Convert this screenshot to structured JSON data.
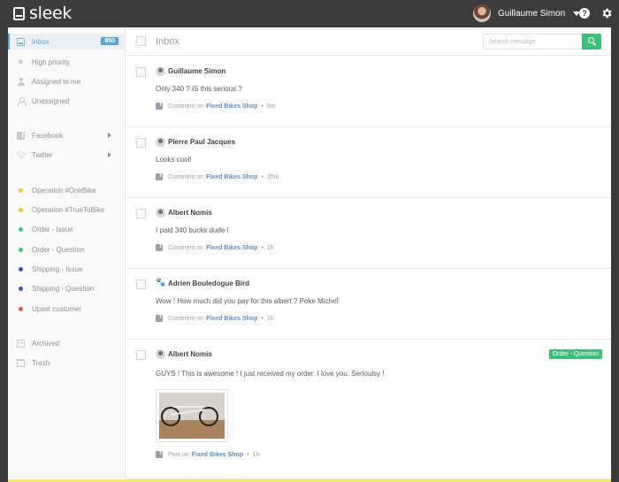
{
  "app": {
    "name": "sleek"
  },
  "user": {
    "name": "Guillaume Simon"
  },
  "sidebar": {
    "items": [
      {
        "label": "Inbox",
        "badge": "850"
      },
      {
        "label": "High priority"
      },
      {
        "label": "Assigned to me"
      },
      {
        "label": "Unassigned"
      },
      {
        "label": "Facebook"
      },
      {
        "label": "Twitter"
      },
      {
        "label": "Operation #OneBike",
        "color": "#f5c542"
      },
      {
        "label": "Operation #TrueToBike",
        "color": "#f5c542"
      },
      {
        "label": "Order - Issue",
        "color": "#3fc07a"
      },
      {
        "label": "Order - Question",
        "color": "#3fc07a"
      },
      {
        "label": "Shipping - Issue",
        "color": "#3b5bb5"
      },
      {
        "label": "Shipping - Question",
        "color": "#3b5bb5"
      },
      {
        "label": "Upset customer",
        "color": "#e25b4a"
      },
      {
        "label": "Archived"
      },
      {
        "label": "Trash"
      }
    ]
  },
  "main": {
    "title": "Inbox",
    "search": {
      "placeholder": "Search message"
    },
    "messages": [
      {
        "author": "Guillaume Simon",
        "text": "Only 340 ? IS this serious ?",
        "kind": "Comment on",
        "source": "Fixed Bikes Shop",
        "sep": "•",
        "time": "6m"
      },
      {
        "author": "Pierre Paul Jacques",
        "text": "Looks cool!",
        "kind": "Comment on",
        "source": "Fixed Bikes Shop",
        "sep": "•",
        "time": "35m"
      },
      {
        "author": "Albert Nomis",
        "text": "I paid 340 bucks dude !",
        "kind": "Comment on",
        "source": "Fixed Bikes Shop",
        "sep": "•",
        "time": "1h"
      },
      {
        "author": "Adrien Bouledogue Bird",
        "text": "Wow ! How much did you pay for this albert ? Poke Michel",
        "kind": "Comment on",
        "source": "Fixed Bikes Shop",
        "sep": "•",
        "time": "1h"
      },
      {
        "author": "Albert Nomis",
        "text": "GUYS ! This is awesome ! I just received my order. I love you. Serioulsy !",
        "kind": "Post on",
        "source": "Fixed Bikes Shop",
        "sep": "•",
        "time": "1h",
        "tag": "Order - Question"
      }
    ]
  },
  "colors": {
    "accent": "#5aa3d8",
    "green": "#3fc07a"
  }
}
